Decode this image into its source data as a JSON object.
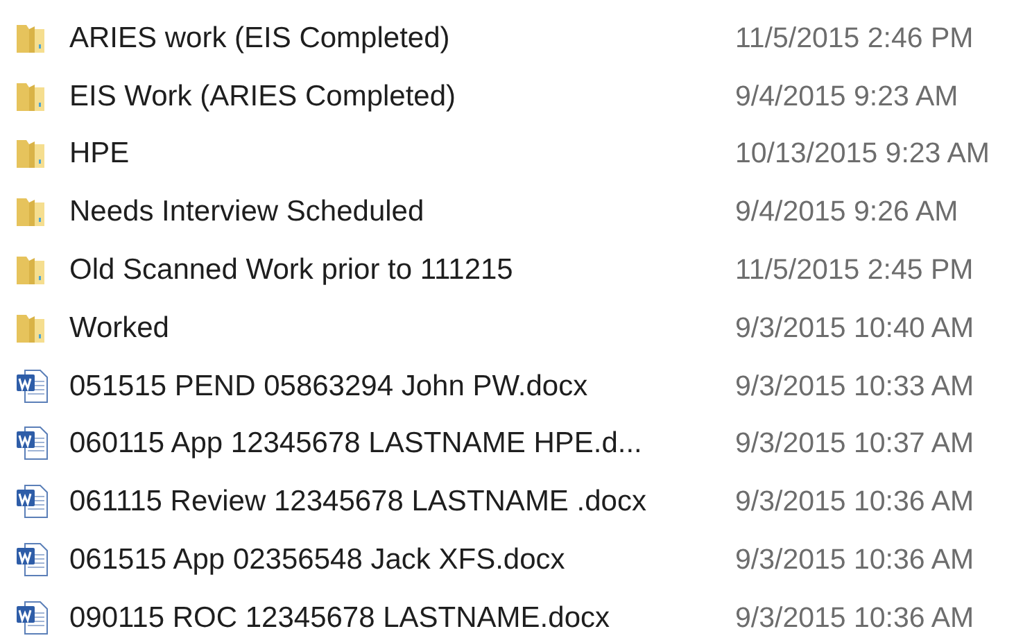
{
  "files": [
    {
      "kind": "folder",
      "name": "ARIES work (EIS Completed)",
      "modified": "11/5/2015 2:46 PM"
    },
    {
      "kind": "folder",
      "name": "EIS Work (ARIES Completed)",
      "modified": "9/4/2015 9:23 AM"
    },
    {
      "kind": "folder",
      "name": "HPE",
      "modified": "10/13/2015 9:23 AM"
    },
    {
      "kind": "folder",
      "name": "Needs Interview Scheduled",
      "modified": "9/4/2015 9:26 AM"
    },
    {
      "kind": "folder",
      "name": "Old Scanned Work prior to 111215",
      "modified": "11/5/2015 2:45 PM"
    },
    {
      "kind": "folder",
      "name": "Worked",
      "modified": "9/3/2015 10:40 AM"
    },
    {
      "kind": "document",
      "name": "051515 PEND 05863294 John PW.docx",
      "modified": "9/3/2015 10:33 AM"
    },
    {
      "kind": "document",
      "name": "060115 App 12345678 LASTNAME HPE.d...",
      "modified": "9/3/2015 10:37 AM"
    },
    {
      "kind": "document",
      "name": "061115 Review 12345678 LASTNAME .docx",
      "modified": "9/3/2015 10:36 AM"
    },
    {
      "kind": "document",
      "name": "061515 App 02356548 Jack XFS.docx",
      "modified": "9/3/2015 10:36 AM"
    },
    {
      "kind": "document",
      "name": "090115 ROC 12345678 LASTNAME.docx",
      "modified": "9/3/2015 10:36 AM"
    }
  ]
}
